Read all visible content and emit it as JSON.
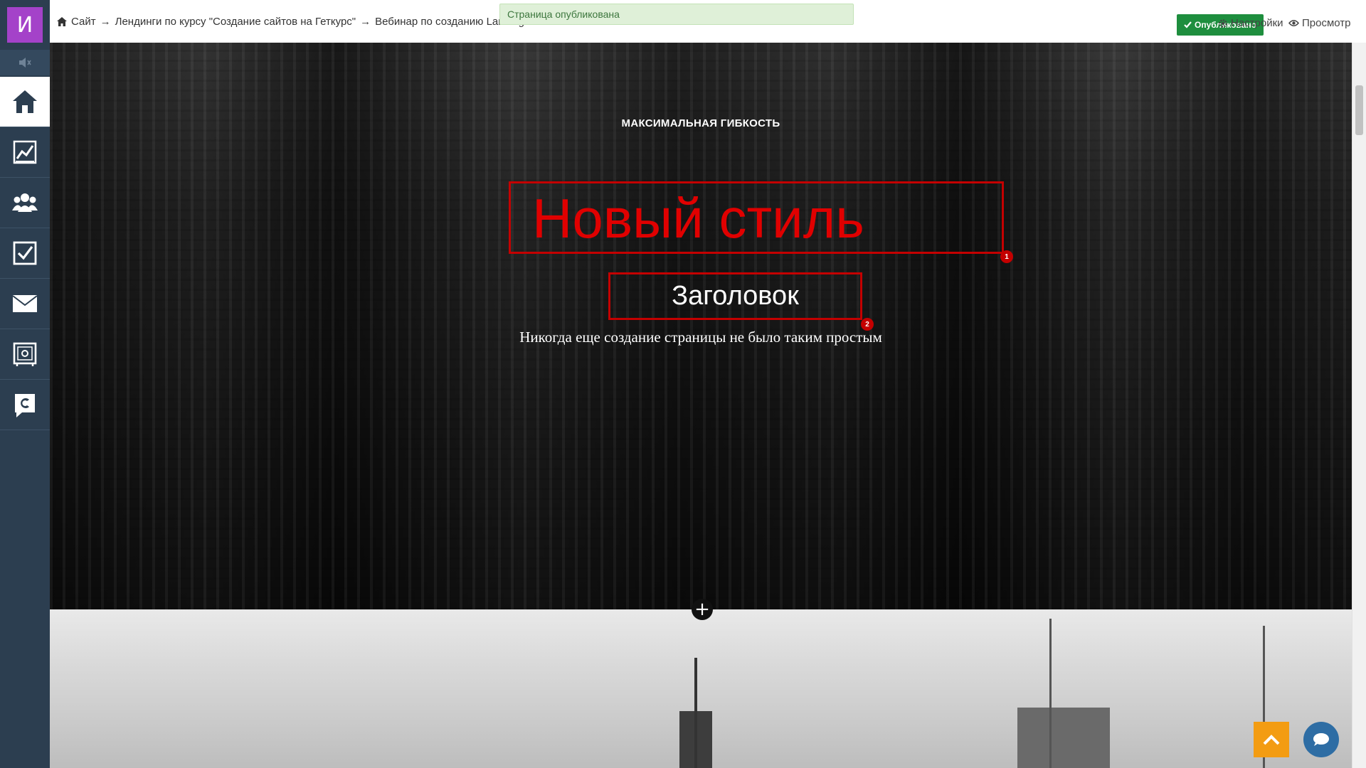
{
  "sidebar": {
    "avatar_letter": "И",
    "items": [
      {
        "name": "home",
        "icon": "home-icon",
        "active": true
      },
      {
        "name": "analytics",
        "icon": "chart-icon",
        "active": false
      },
      {
        "name": "users",
        "icon": "users-icon",
        "active": false
      },
      {
        "name": "tasks",
        "icon": "checkbox-icon",
        "active": false
      },
      {
        "name": "messages",
        "icon": "envelope-icon",
        "active": false
      },
      {
        "name": "sales",
        "icon": "safe-icon",
        "active": false
      },
      {
        "name": "getcourse",
        "icon": "getcourse-logo-icon",
        "active": false
      }
    ],
    "colors": {
      "bg": "#2c3e50",
      "avatar": "#a442c9"
    }
  },
  "topbar": {
    "breadcrumb": [
      "Сайт",
      "Лендинги по курсу \"Создание сайтов на Геткурс\"",
      "Вебинар по созданию Landing Pa"
    ],
    "separator": "→",
    "toast": "Страница опубликована",
    "published_label": "Опубликовано",
    "settings_label": "Настройки",
    "preview_label": "Просмотр"
  },
  "hero": {
    "eyebrow": "МАКСИМАЛЬНАЯ ГИБКОСТЬ",
    "title": "Новый стиль",
    "title_badge": "1",
    "heading": "Заголовок",
    "heading_badge": "2",
    "subtitle": "Никогда еще создание страницы не было таким простым"
  },
  "add_block_symbol": "+",
  "colors": {
    "accent_red": "#c40000",
    "published_green": "#1e8e3e",
    "scroll_top": "#f39c12",
    "chat": "#2e6da4"
  }
}
